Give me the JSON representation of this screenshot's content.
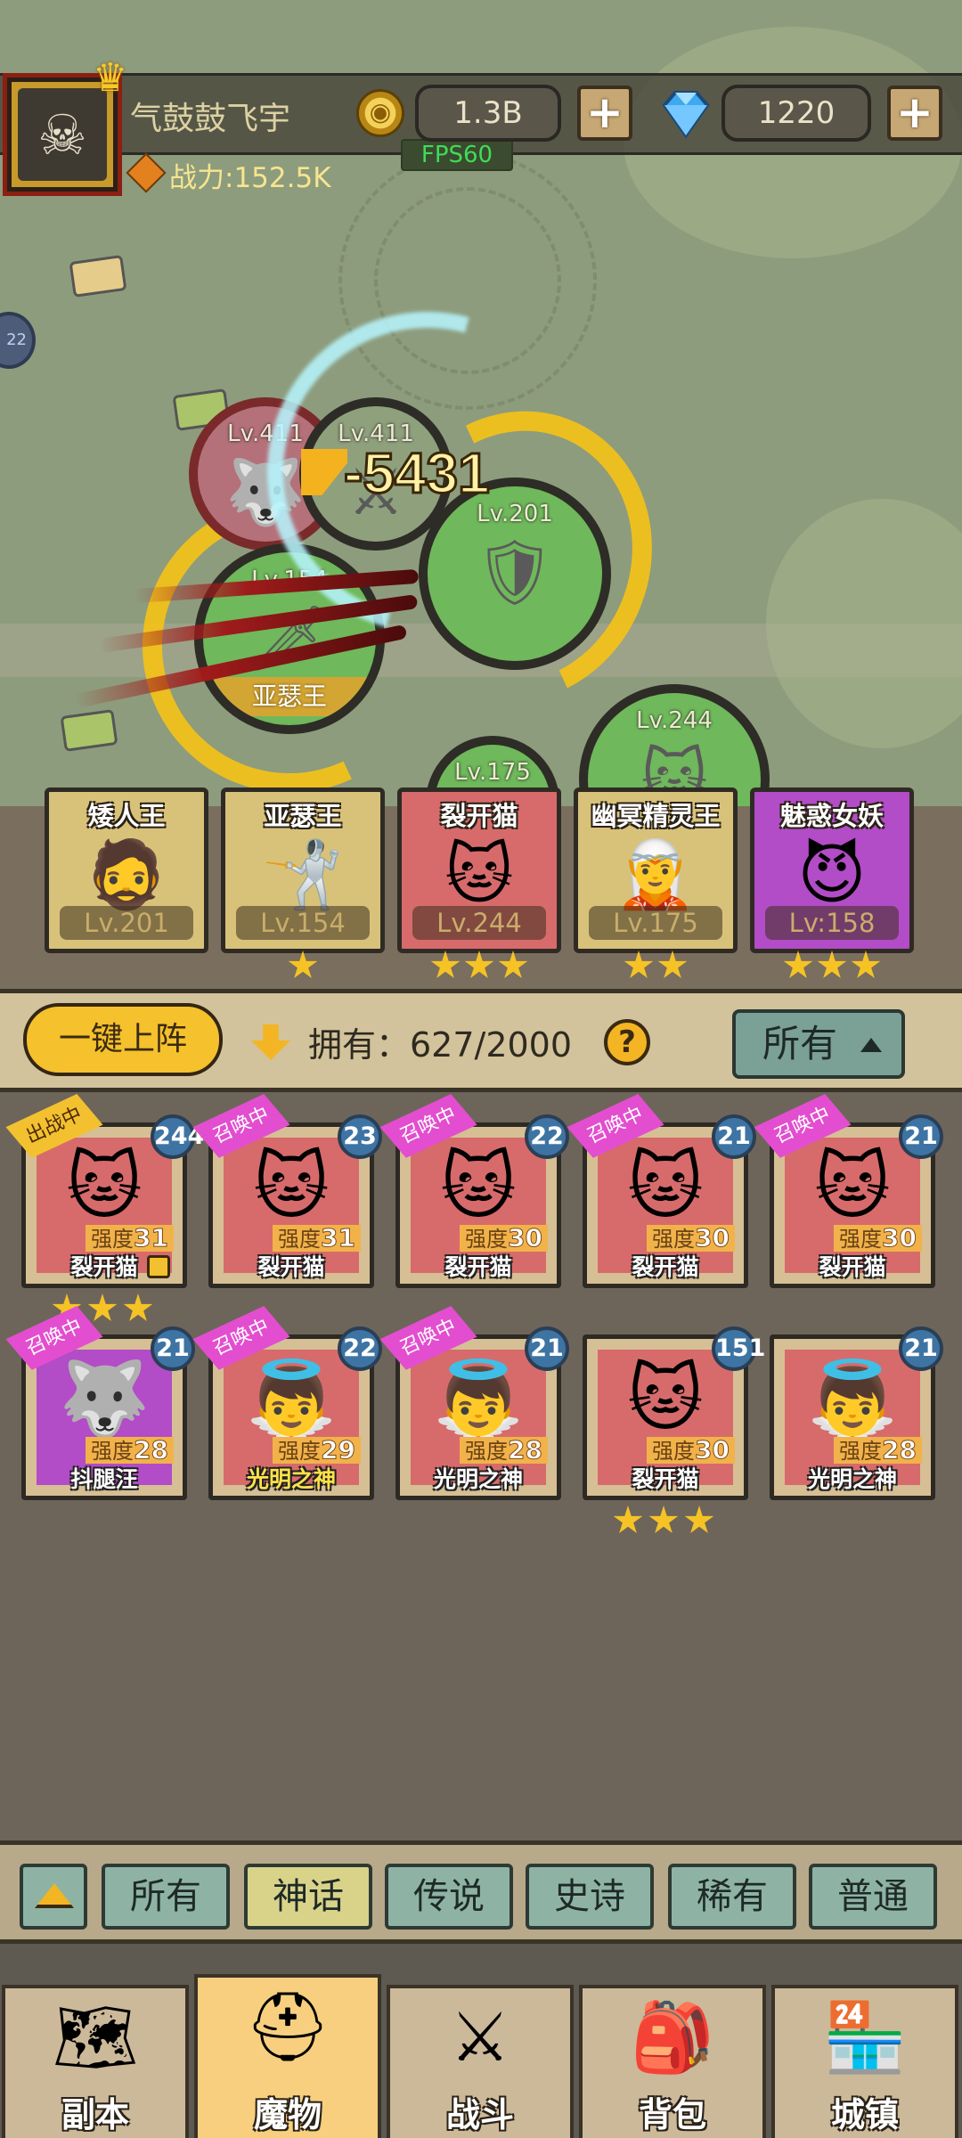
{
  "player": {
    "name": "气鼓鼓飞宇",
    "power": "战力:152.5K",
    "fps": "FPS60"
  },
  "currency": {
    "gold": "1.3B",
    "gems": "1220",
    "add_symbol": "+"
  },
  "battle": {
    "damage": "-5431",
    "units": [
      {
        "level": "Lv.411",
        "tag": ""
      },
      {
        "level": "Lv.411",
        "tag": ""
      },
      {
        "level": "Lv.201",
        "tag": ""
      },
      {
        "level": "Lv.154",
        "tag": "亚瑟王"
      },
      {
        "level": "Lv.244",
        "tag": ""
      },
      {
        "level": "Lv.175",
        "tag": ""
      }
    ],
    "side_badge": "22"
  },
  "lineup": [
    {
      "name": "矮人王",
      "level": "Lv.201",
      "stars": 0,
      "color": "#d8c27a"
    },
    {
      "name": "亚瑟王",
      "level": "Lv.154",
      "stars": 1,
      "color": "#d8c27a"
    },
    {
      "name": "裂开猫",
      "level": "Lv.244",
      "stars": 3,
      "color": "#d76b6b"
    },
    {
      "name": "幽冥精灵王",
      "level": "Lv.175",
      "stars": 2,
      "color": "#d8c27a"
    },
    {
      "name": "魅惑女妖",
      "level": "Lv:158",
      "stars": 3,
      "color": "#b24cc7"
    }
  ],
  "toolbar": {
    "one_key_label": "一键上阵",
    "own_label": "拥有：627/2000",
    "help_symbol": "?",
    "filter_label": "所有"
  },
  "monsters": [
    {
      "name": "裂开猫",
      "badge": "244",
      "ribbon": "出战中",
      "strength_label": "强度",
      "strength": "31",
      "stars": 3,
      "locked": true
    },
    {
      "name": "裂开猫",
      "badge": "23",
      "ribbon": "召唤中",
      "strength_label": "强度",
      "strength": "31",
      "stars": 0,
      "locked": false
    },
    {
      "name": "裂开猫",
      "badge": "22",
      "ribbon": "召唤中",
      "strength_label": "强度",
      "strength": "30",
      "stars": 0,
      "locked": false
    },
    {
      "name": "裂开猫",
      "badge": "21",
      "ribbon": "召唤中",
      "strength_label": "强度",
      "strength": "30",
      "stars": 0,
      "locked": false
    },
    {
      "name": "裂开猫",
      "badge": "21",
      "ribbon": "召唤中",
      "strength_label": "强度",
      "strength": "30",
      "stars": 0,
      "locked": false
    },
    {
      "name": "抖腿汪",
      "badge": "21",
      "ribbon": "召唤中",
      "strength_label": "强度",
      "strength": "28",
      "stars": 0,
      "locked": false
    },
    {
      "name": "光明之神",
      "badge": "22",
      "ribbon": "召唤中",
      "strength_label": "强度",
      "strength": "29",
      "stars": 0,
      "locked": false
    },
    {
      "name": "光明之神",
      "badge": "21",
      "ribbon": "召唤中",
      "strength_label": "强度",
      "strength": "28",
      "stars": 0,
      "locked": false
    },
    {
      "name": "裂开猫",
      "badge": "151",
      "ribbon": "",
      "strength_label": "强度",
      "strength": "30",
      "stars": 3,
      "locked": false
    },
    {
      "name": "光明之神",
      "badge": "21",
      "ribbon": "",
      "strength_label": "强度",
      "strength": "28",
      "stars": 0,
      "locked": false
    }
  ],
  "tier_tabs": [
    "所有",
    "神话",
    "传说",
    "史诗",
    "稀有",
    "普通"
  ],
  "active_tier": "神话",
  "nav": [
    {
      "label": "副本",
      "icon": "map-icon"
    },
    {
      "label": "魔物",
      "icon": "helmet-icon"
    },
    {
      "label": "战斗",
      "icon": "swords-icon"
    },
    {
      "label": "背包",
      "icon": "backpack-icon"
    },
    {
      "label": "城镇",
      "icon": "shop-icon"
    }
  ],
  "active_nav": "魔物"
}
